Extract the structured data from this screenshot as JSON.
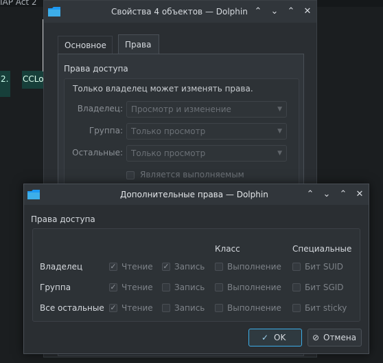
{
  "desktop": {
    "top_text": "IAP Act 2",
    "tile1": "2.",
    "tile2": "CCLo"
  },
  "back_window": {
    "title": "Свойства 4 объектов — Dolphin",
    "tabs": [
      {
        "label": "Основное",
        "active": false
      },
      {
        "label": "Права",
        "active": true
      }
    ],
    "section_title": "Права доступа",
    "note": "Только владелец может изменять права.",
    "rows": [
      {
        "label": "Владелец:",
        "value": "Просмотр и изменение"
      },
      {
        "label": "Группа:",
        "value": "Только просмотр"
      },
      {
        "label": "Остальные:",
        "value": "Только просмотр"
      }
    ],
    "executable_label": "Является выполняемым"
  },
  "dialog": {
    "title": "Дополнительные права — Dolphin",
    "section_title": "Права доступа",
    "column_headers": {
      "class": "Класс",
      "special": "Специальные"
    },
    "rows": [
      {
        "label": "Владелец",
        "read": {
          "label": "Чтение",
          "checked": true
        },
        "write": {
          "label": "Запись",
          "checked": true
        },
        "exec": {
          "label": "Выполнение",
          "checked": false
        },
        "special": {
          "label": "Бит SUID",
          "checked": false
        }
      },
      {
        "label": "Группа",
        "read": {
          "label": "Чтение",
          "checked": true
        },
        "write": {
          "label": "Запись",
          "checked": false
        },
        "exec": {
          "label": "Выполнение",
          "checked": false
        },
        "special": {
          "label": "Бит SGID",
          "checked": false
        }
      },
      {
        "label": "Все остальные",
        "read": {
          "label": "Чтение",
          "checked": true
        },
        "write": {
          "label": "Запись",
          "checked": false
        },
        "exec": {
          "label": "Выполнение",
          "checked": false
        },
        "special": {
          "label": "Бит sticky",
          "checked": false
        }
      }
    ],
    "ok_label": "OK",
    "cancel_label": "Отмена"
  },
  "colors": {
    "accent": "#3daee9",
    "window_bg": "#2a2e32",
    "titlebar_bg": "#31363b"
  }
}
